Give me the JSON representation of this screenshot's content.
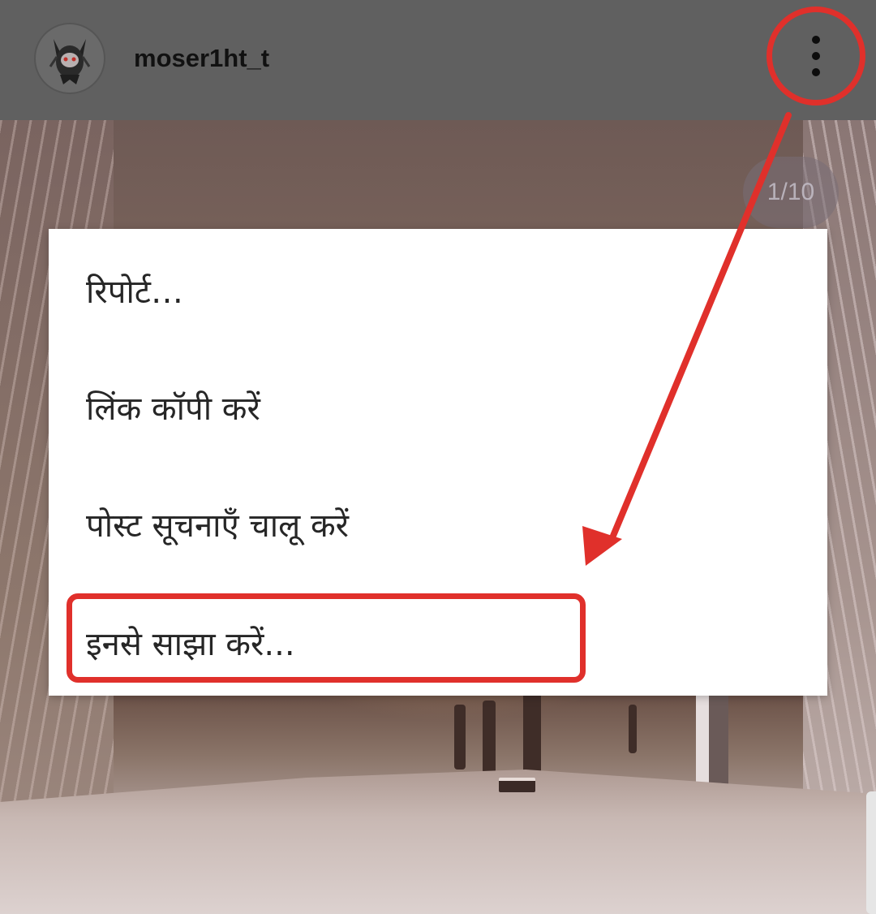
{
  "header": {
    "username": "moser1ht_t",
    "avatar_icon": "devil-mask-avatar-icon",
    "more_icon": "three-dots-vertical-icon"
  },
  "carousel": {
    "counter": "1/10"
  },
  "menu": {
    "items": [
      {
        "label": "रिपोर्ट…"
      },
      {
        "label": "लिंक कॉपी करें"
      },
      {
        "label": "पोस्ट सूचनाएँ चालू करें"
      },
      {
        "label": "इनसे साझा करें..."
      }
    ]
  },
  "annotation": {
    "color": "#e0302b",
    "highlighted_item_index": 3
  }
}
